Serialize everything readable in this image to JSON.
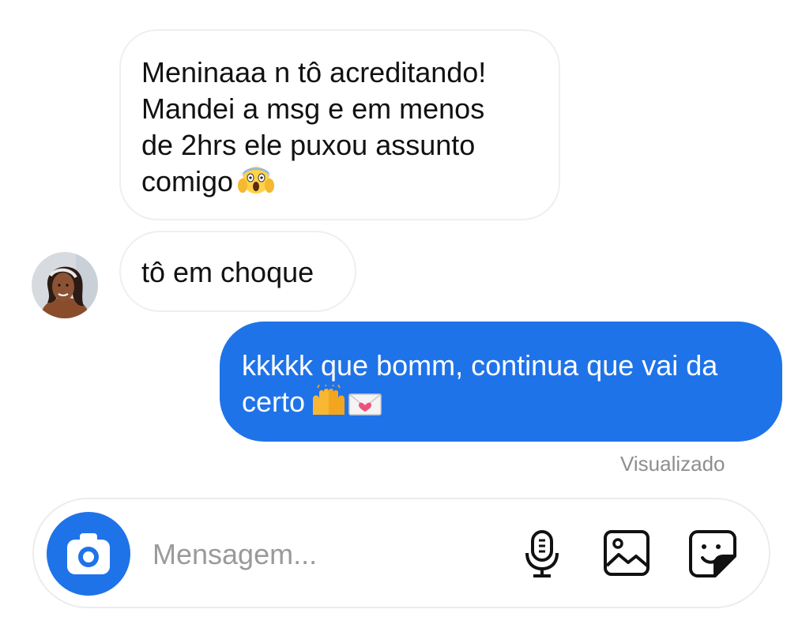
{
  "conversation": {
    "incoming": [
      {
        "lines": [
          "Meninaaa n tô acreditando!",
          "Mandei a msg e em menos",
          "de 2hrs ele puxou assunto",
          "comigo"
        ],
        "emoji": "😱"
      },
      {
        "lines": [
          "tô em choque"
        ]
      }
    ],
    "outgoing": {
      "lines": [
        "kkkkk que bomm, continua que vai da",
        "certo"
      ],
      "emoji": "🙌💌"
    },
    "seen_status": "Visualizado"
  },
  "composer": {
    "placeholder": "Mensagem..."
  },
  "icons": {
    "camera": "camera-icon",
    "microphone": "microphone-icon",
    "gallery": "image-icon",
    "sticker": "sticker-icon"
  },
  "colors": {
    "accent": "#1f73e8",
    "incoming_border": "#efefef",
    "muted_text": "#8e8e8e"
  }
}
